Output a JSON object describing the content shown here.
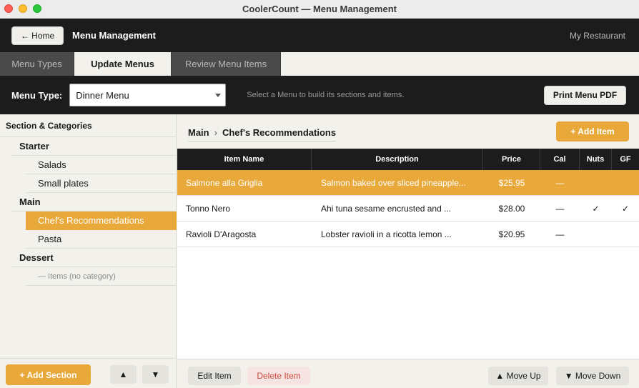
{
  "window": {
    "title": "CoolerCount — Menu Management"
  },
  "header": {
    "home_label": "← Home",
    "title": "Menu Management",
    "restaurant": "My Restaurant"
  },
  "tabs": [
    {
      "label": "Menu Types",
      "active": false
    },
    {
      "label": "Update Menus",
      "active": true
    },
    {
      "label": "Review Menu Items",
      "active": false
    }
  ],
  "menubar": {
    "label": "Menu Type:",
    "selected_menu": "Dinner Menu",
    "hint": "Select a Menu to build its sections and items.",
    "print_label": "Print Menu PDF"
  },
  "sidebar": {
    "header": "Section & Categories",
    "sections": [
      {
        "name": "Starter",
        "categories": [
          "Salads",
          "Small plates"
        ]
      },
      {
        "name": "Main",
        "categories": [
          "Chef's Recommendations",
          "Pasta"
        ]
      },
      {
        "name": "Dessert",
        "categories": [
          "— Items (no category)"
        ]
      }
    ],
    "selected_category": "Chef's Recommendations",
    "add_section_label": "+ Add Section",
    "up_label": "▲",
    "down_label": "▼"
  },
  "main": {
    "breadcrumb_section": "Main",
    "breadcrumb_sep": "›",
    "breadcrumb_category": "Chef's Recommendations",
    "add_item_label": "+ Add Item",
    "columns": [
      "Item Name",
      "Description",
      "Price",
      "Cal",
      "Nuts",
      "GF"
    ],
    "rows": [
      {
        "name": "Salmone alla Griglia",
        "description": "Salmon baked over sliced pineapple...",
        "price": "$25.95",
        "cal": "—",
        "nuts": "",
        "gf": "",
        "selected": true
      },
      {
        "name": "Tonno Nero",
        "description": "Ahi tuna sesame encrusted and ...",
        "price": "$28.00",
        "cal": "—",
        "nuts": "✓",
        "gf": "✓",
        "selected": false
      },
      {
        "name": "Ravioli D'Aragosta",
        "description": "Lobster ravioli in a ricotta lemon ...",
        "price": "$20.95",
        "cal": "—",
        "nuts": "",
        "gf": "",
        "selected": false
      }
    ],
    "edit_label": "Edit Item",
    "delete_label": "Delete Item",
    "move_up_label": "▲ Move Up",
    "move_down_label": "▼ Move Down"
  },
  "colors": {
    "accent": "#e8a83a",
    "dark": "#1c1c1c",
    "danger": "#c94a3d"
  }
}
